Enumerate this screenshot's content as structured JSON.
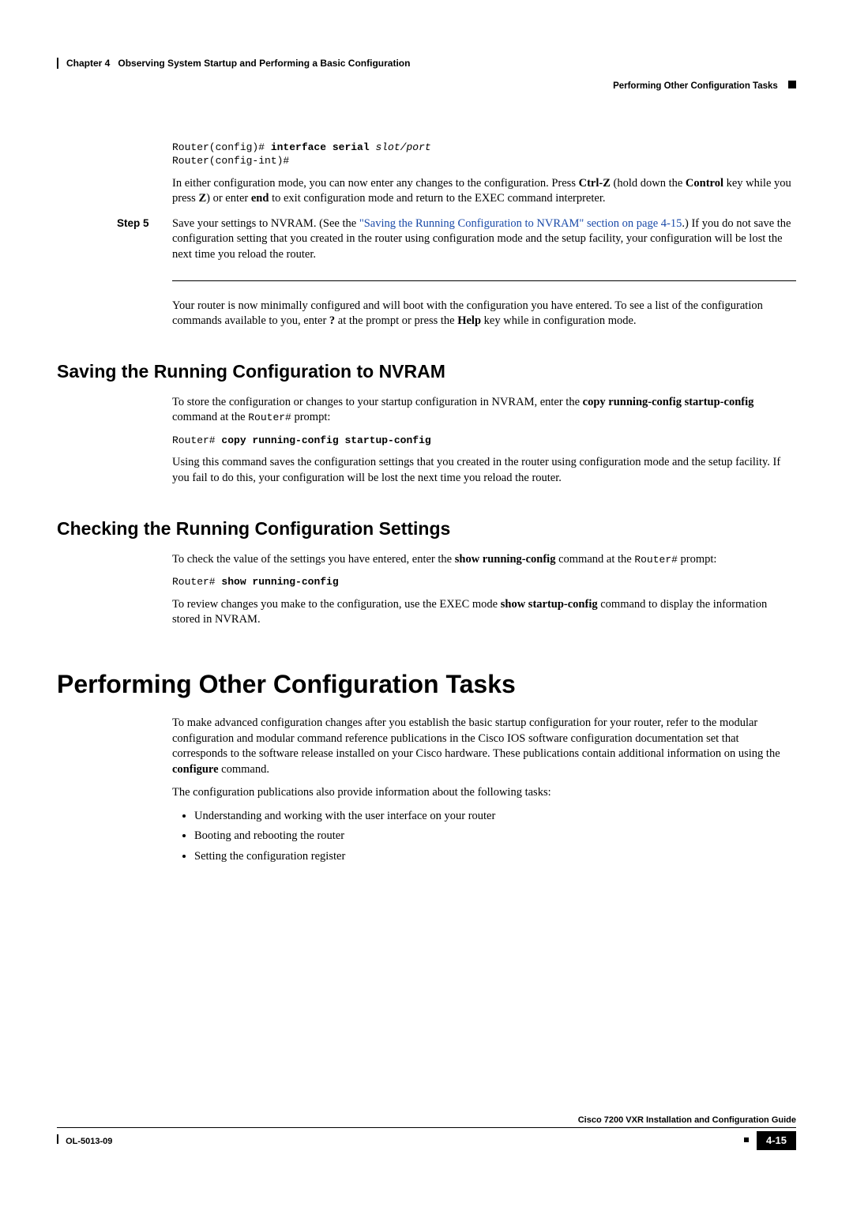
{
  "header": {
    "chapter_label": "Chapter 4",
    "chapter_title": "Observing System Startup and Performing a Basic Configuration",
    "section_title": "Performing Other Configuration Tasks"
  },
  "code1": {
    "prompt1": "Router(config)# ",
    "cmd1": "interface serial",
    "arg1": " slot/port",
    "prompt2": "Router(config-int)#"
  },
  "para1_a": "In either configuration mode, you can now enter any changes to the configuration. Press ",
  "para1_b": "Ctrl-Z",
  "para1_c": " (hold down the ",
  "para1_d": "Control",
  "para1_e": " key while you press ",
  "para1_f": "Z",
  "para1_g": ") or enter ",
  "para1_h": "end",
  "para1_i": " to exit configuration mode and return to the EXEC command interpreter.",
  "step5": {
    "label": "Step 5",
    "a": "Save your settings to NVRAM. (See the ",
    "link": "\"Saving the Running Configuration to NVRAM\" section on page 4-15",
    "b": ".) If you do not save the configuration setting that you created in the router using configuration mode and the setup facility, your configuration will be lost the next time you reload the router."
  },
  "para2_a": "Your router is now minimally configured and will boot with the configuration you have entered. To see a list of the configuration commands available to you, enter ",
  "para2_b": "?",
  "para2_c": " at the prompt or press the ",
  "para2_d": "Help",
  "para2_e": " key while in configuration mode.",
  "h2_1": "Saving the Running Configuration to NVRAM",
  "p_nvram_a": "To store the configuration or changes to your startup configuration in NVRAM, enter the ",
  "p_nvram_b": "copy running-config startup-config",
  "p_nvram_c": " command at the ",
  "p_nvram_prompt": "Router#",
  "p_nvram_d": " prompt:",
  "code_nvram_prompt": "Router# ",
  "code_nvram_cmd": "copy running-config startup-config",
  "p_nvram2": "Using this command saves the configuration settings that you created in the router using configuration mode and the setup facility. If you fail to do this, your configuration will be lost the next time you reload the router.",
  "h2_2": "Checking the Running Configuration Settings",
  "p_check_a": "To check the value of the settings you have entered, enter the ",
  "p_check_b": "show running-config",
  "p_check_c": " command at the ",
  "p_check_prompt": "Router#",
  "p_check_d": " prompt:",
  "code_check_prompt": "Router# ",
  "code_check_cmd": "show running-config",
  "p_check2_a": "To review changes you make to the configuration, use the EXEC mode ",
  "p_check2_b": "show startup-config",
  "p_check2_c": " command to display the information stored in NVRAM.",
  "h1": "Performing Other Configuration Tasks",
  "p_other_a": "To make advanced configuration changes after you establish the basic startup configuration for your router, refer to the modular configuration and modular command reference publications in the Cisco IOS software configuration documentation set that corresponds to the software release installed on your Cisco hardware. These publications contain additional information on using the ",
  "p_other_b": "configure",
  "p_other_c": " command.",
  "p_other2": "The configuration publications also provide information about the following tasks:",
  "bullets": [
    "Understanding and working with the user interface on your router",
    "Booting and rebooting the router",
    "Setting the configuration register"
  ],
  "footer": {
    "guide": "Cisco 7200 VXR Installation and Configuration Guide",
    "docnum": "OL-5013-09",
    "page": "4-15"
  }
}
